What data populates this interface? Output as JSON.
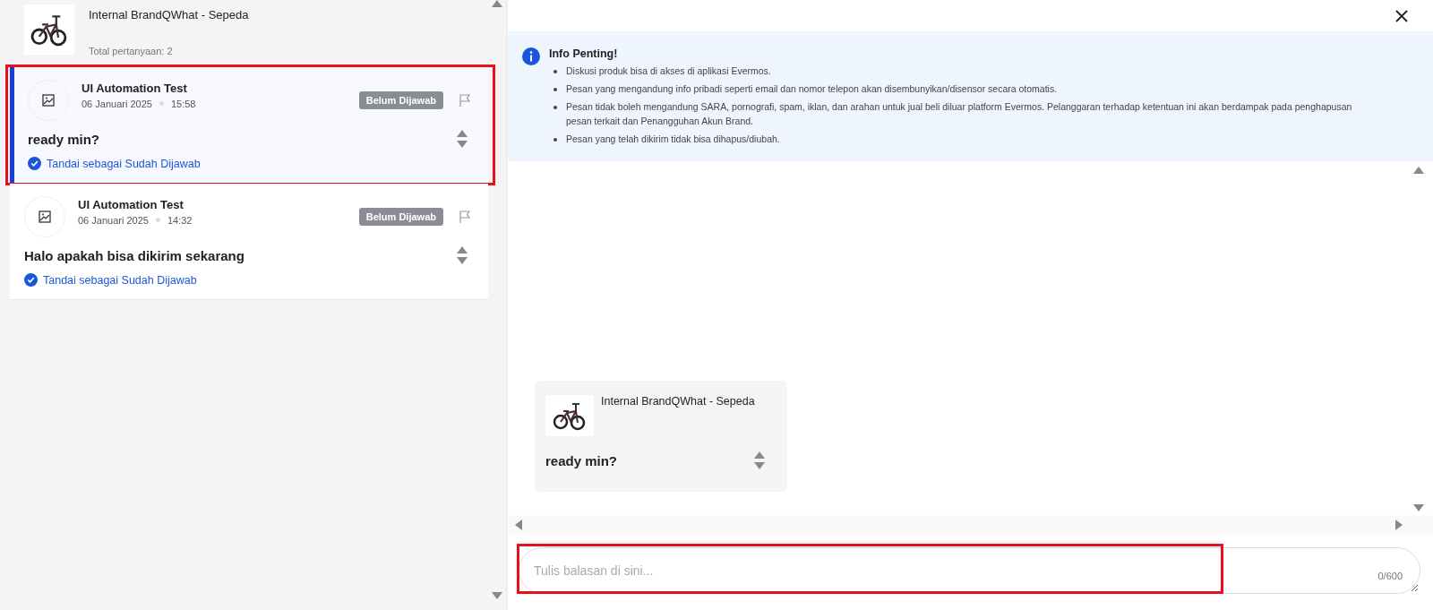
{
  "product": {
    "name": "Internal BrandQWhat - Sepeda",
    "total": "Total pertanyaan: 2"
  },
  "questions": [
    {
      "name": "UI Automation Test",
      "date": "06 Januari 2025",
      "time": "15:58",
      "status": "Belum Dijawab",
      "text": "ready min?",
      "action": "Tandai sebagai Sudah Dijawab",
      "selected": true,
      "highlighted": true
    },
    {
      "name": "UI Automation Test",
      "date": "06 Januari 2025",
      "time": "14:32",
      "status": "Belum Dijawab",
      "text": "Halo apakah bisa dikirim sekarang",
      "action": "Tandai sebagai Sudah Dijawab",
      "selected": false,
      "highlighted": false
    }
  ],
  "info": {
    "title": "Info Penting!",
    "items": [
      "Diskusi produk bisa di akses di aplikasi Evermos.",
      "Pesan yang mengandung info pribadi seperti email dan nomor telepon akan disembunyikan/disensor secara otomatis.",
      "Pesan tidak boleh mengandung SARA, pornografi, spam, iklan, dan arahan untuk jual beli diluar platform Evermos. Pelanggaran terhadap ketentuan ini akan berdampak pada penghapusan pesan terkait dan Penangguhan Akun Brand.",
      "Pesan yang telah dikirim tidak bisa dihapus/diubah."
    ]
  },
  "chat": {
    "messages": [
      {
        "product": "Internal BrandQWhat - Sepeda",
        "text": "ready min?"
      }
    ]
  },
  "reply": {
    "placeholder": "Tulis balasan di sini...",
    "counter": "0/600",
    "highlighted": true
  }
}
